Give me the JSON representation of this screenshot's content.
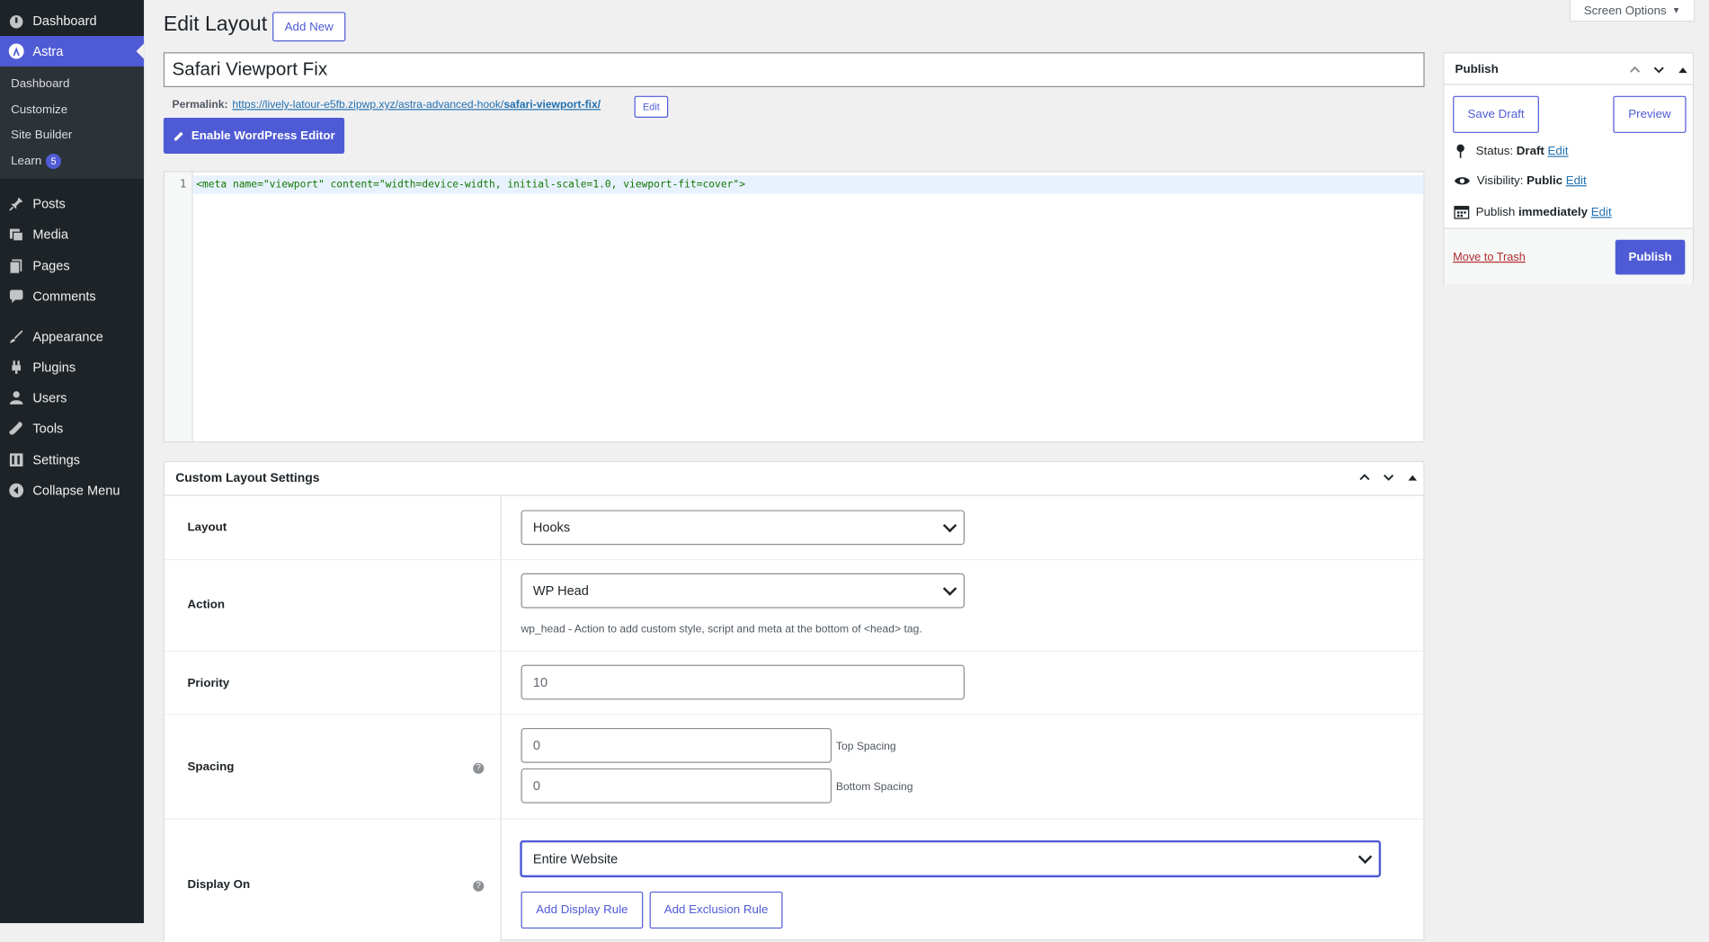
{
  "sidebar": {
    "top_items": [
      {
        "label": "Dashboard",
        "icon": "dashboard-icon"
      },
      {
        "label": "Astra",
        "icon": "astra-icon"
      }
    ],
    "astra_submenu": [
      {
        "label": "Dashboard"
      },
      {
        "label": "Customize"
      },
      {
        "label": "Site Builder"
      },
      {
        "label": "Learn",
        "badge": "5"
      }
    ],
    "main_items": [
      {
        "label": "Posts",
        "icon": "pin-icon"
      },
      {
        "label": "Media",
        "icon": "media-icon"
      },
      {
        "label": "Pages",
        "icon": "pages-icon"
      },
      {
        "label": "Comments",
        "icon": "comment-icon"
      },
      {
        "label": "Appearance",
        "icon": "brush-icon"
      },
      {
        "label": "Plugins",
        "icon": "plugin-icon"
      },
      {
        "label": "Users",
        "icon": "user-icon"
      },
      {
        "label": "Tools",
        "icon": "wrench-icon"
      },
      {
        "label": "Settings",
        "icon": "settings-icon"
      },
      {
        "label": "Collapse Menu",
        "icon": "collapse-icon"
      }
    ]
  },
  "header": {
    "title": "Edit Layout",
    "add_new": "Add New",
    "screen_options": "Screen Options"
  },
  "post": {
    "title": "Safari Viewport Fix",
    "permalink_label": "Permalink:",
    "permalink_url_base": "https://lively-latour-e5fb.zipwp.xyz/astra-advanced-hook/",
    "permalink_slug": "safari-viewport-fix/",
    "permalink_edit": "Edit",
    "enable_editor": "Enable WordPress Editor"
  },
  "code_editor": {
    "line_number": "1",
    "code": "<meta name=\"viewport\" content=\"width=device-width, initial-scale=1.0, viewport-fit=cover\">"
  },
  "settings_box": {
    "title": "Custom Layout Settings",
    "rows": {
      "layout": {
        "label": "Layout",
        "value": "Hooks"
      },
      "action": {
        "label": "Action",
        "value": "WP Head",
        "description": "wp_head - Action to add custom style, script and meta at the bottom of <head> tag."
      },
      "priority": {
        "label": "Priority",
        "value": "10"
      },
      "spacing": {
        "label": "Spacing",
        "top_value": "0",
        "top_label": "Top Spacing",
        "bottom_value": "0",
        "bottom_label": "Bottom Spacing"
      },
      "display_on": {
        "label": "Display On",
        "value": "Entire Website",
        "add_display_rule": "Add Display Rule",
        "add_exclusion_rule": "Add Exclusion Rule"
      }
    }
  },
  "publish_box": {
    "title": "Publish",
    "save_draft": "Save Draft",
    "preview": "Preview",
    "status_label": "Status:",
    "status_value": "Draft",
    "visibility_label": "Visibility:",
    "visibility_value": "Public",
    "publish_label": "Publish",
    "publish_value": "immediately",
    "edit": "Edit",
    "move_to_trash": "Move to Trash",
    "publish_button": "Publish"
  },
  "colors": {
    "accent": "#4f5bd5",
    "sidebar_bg": "#1d2327",
    "link": "#2271b1",
    "trash": "#b32d2e"
  }
}
